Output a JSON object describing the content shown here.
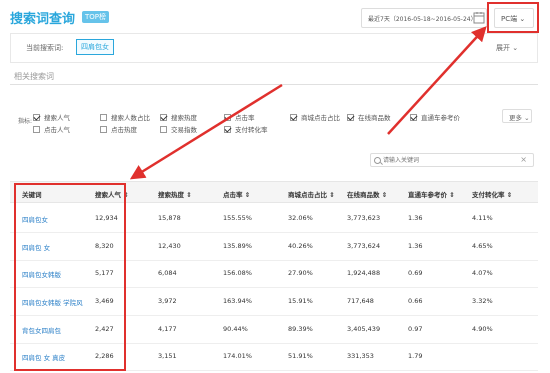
{
  "header": {
    "title": "搜索词查询",
    "badge": "TOP榜",
    "date_range": "最近7天（2016-05-18~2016-05-24）",
    "device": "PC端"
  },
  "keyword_bar": {
    "label": "当前搜索词:",
    "current": "四肩包女",
    "expand": "展开"
  },
  "section_title": "相关搜索词",
  "metrics": {
    "label": "指标:",
    "row1": [
      {
        "label": "搜索人气",
        "checked": true
      },
      {
        "label": "搜索人数占比",
        "checked": false
      },
      {
        "label": "搜索热度",
        "checked": true
      },
      {
        "label": "点击率",
        "checked": true
      },
      {
        "label": "商城点击占比",
        "checked": true
      },
      {
        "label": "在线商品数",
        "checked": true
      },
      {
        "label": "直通车参考价",
        "checked": true
      }
    ],
    "row2": [
      {
        "label": "点击人气",
        "checked": false
      },
      {
        "label": "点击热度",
        "checked": false
      },
      {
        "label": "交易指数",
        "checked": false
      },
      {
        "label": "支付转化率",
        "checked": true
      }
    ],
    "more": "更多"
  },
  "search": {
    "placeholder": "请输入关键词",
    "clear": "×"
  },
  "table": {
    "headers": [
      "关键词",
      "搜索人气 ⇕",
      "搜索热度 ⇕",
      "点击率 ⇕",
      "商城点击占比 ⇕",
      "在线商品数 ⇕",
      "直通车参考价 ⇕",
      "支付转化率 ⇕"
    ],
    "rows": [
      [
        "四肩包女",
        "12,934",
        "15,878",
        "155.55%",
        "32.06%",
        "3,773,623",
        "1.36",
        "4.11%"
      ],
      [
        "四肩包 女",
        "8,320",
        "12,430",
        "135.89%",
        "40.26%",
        "3,773,624",
        "1.36",
        "4.65%"
      ],
      [
        "四肩包女韩版",
        "5,177",
        "6,084",
        "156.08%",
        "27.90%",
        "1,924,488",
        "0.69",
        "4.07%"
      ],
      [
        "四肩包女韩版 学院风",
        "3,469",
        "3,972",
        "163.94%",
        "15.91%",
        "717,648",
        "0.66",
        "3.32%"
      ],
      [
        "背包女四肩包",
        "2,427",
        "4,177",
        "90.44%",
        "89.39%",
        "3,405,439",
        "0.97",
        "4.90%"
      ],
      [
        "四肩包 女 真皮",
        "2,286",
        "3,151",
        "174.01%",
        "51.91%",
        "331,353",
        "1.79",
        ""
      ]
    ]
  },
  "colors": {
    "accent": "#2aa7dc",
    "annotation": "#e0302d",
    "link": "#2a7fc7"
  }
}
